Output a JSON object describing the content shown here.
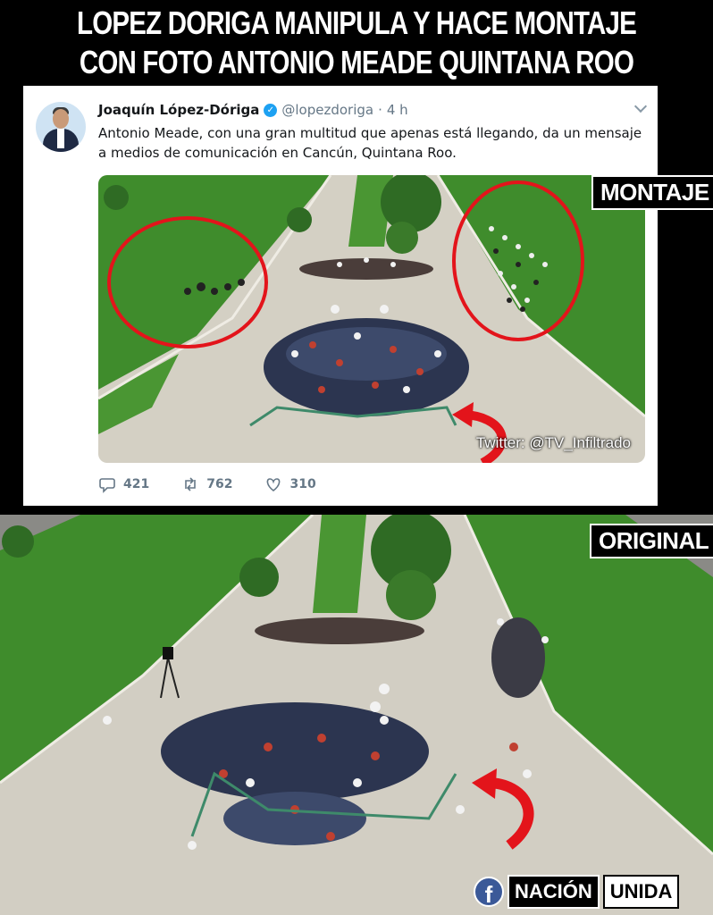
{
  "headline": {
    "line1": "LOPEZ DORIGA MANIPULA Y HACE MONTAJE",
    "line2": "CON FOTO ANTONIO MEADE QUINTANA ROO"
  },
  "tweet": {
    "name": "Joaquín López-Dóriga",
    "handle": "@lopezdoriga",
    "dot": "·",
    "time": "4 h",
    "verified_mark": "✓",
    "text": "Antonio Meade, con una gran multitud que apenas está llegando, da un mensaje a medios de comunicación en Cancún, Quintana Roo.",
    "watermark": "Twitter: @TV_Infiltrado",
    "replies": "421",
    "retweets": "762",
    "likes": "310"
  },
  "labels": {
    "montaje": "MONTAJE",
    "original": "ORIGINAL"
  },
  "brand": {
    "icon_letter": "f",
    "part1": "NACIÓN",
    "part2": "UNIDA"
  },
  "colors": {
    "circle": "#e3141b",
    "arrow": "#e3141b",
    "grass": "#3f8c2c",
    "path": "#d7d3c8"
  }
}
